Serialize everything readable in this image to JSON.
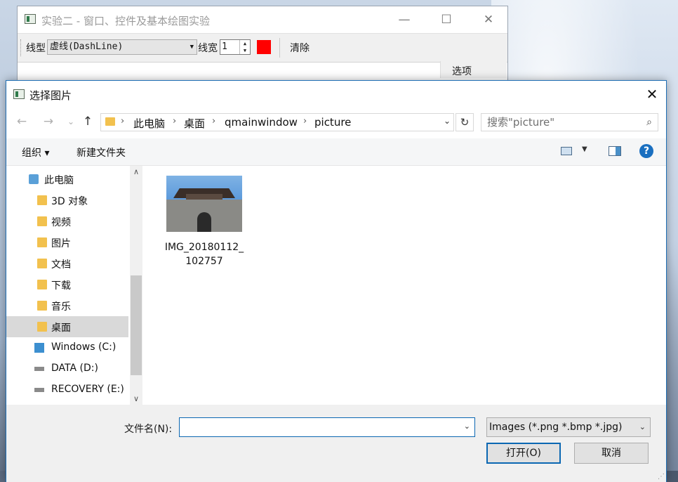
{
  "main_window": {
    "title": "实验二 - 窗口、控件及基本绘图实验",
    "controls": {
      "minimize": "—",
      "maximize": "☐",
      "close": "✕"
    },
    "toolbar": {
      "line_type_label": "线型",
      "line_type_value": "虚线(DashLine)",
      "line_width_label": "线宽",
      "line_width_value": "1",
      "color": "#ff0000",
      "clear_label": "清除"
    },
    "options_tab": "选项"
  },
  "dialog": {
    "title": "选择图片",
    "close": "✕",
    "nav": {
      "back": "←",
      "forward": "→",
      "recent": "⌄",
      "up": "↑",
      "refresh": "↻"
    },
    "breadcrumbs": [
      "此电脑",
      "桌面",
      "qmainwindow",
      "picture"
    ],
    "search_placeholder": "搜索\"picture\"",
    "commands": {
      "organize": "组织 ▾",
      "new_folder": "新建文件夹"
    },
    "nav_items": [
      {
        "label": "此电脑",
        "icon": "computer-icon"
      },
      {
        "label": "3D 对象",
        "icon": "3d-objects-folder-icon"
      },
      {
        "label": "视频",
        "icon": "videos-folder-icon"
      },
      {
        "label": "图片",
        "icon": "pictures-folder-icon"
      },
      {
        "label": "文档",
        "icon": "documents-folder-icon"
      },
      {
        "label": "下载",
        "icon": "downloads-folder-icon"
      },
      {
        "label": "音乐",
        "icon": "music-folder-icon"
      },
      {
        "label": "桌面",
        "icon": "desktop-folder-icon",
        "selected": true
      },
      {
        "label": "Windows (C:)",
        "icon": "drive-c-icon"
      },
      {
        "label": "DATA (D:)",
        "icon": "drive-icon"
      },
      {
        "label": "RECOVERY (E:)",
        "icon": "drive-icon"
      }
    ],
    "files": [
      {
        "name_line1": "IMG_20180112_",
        "name_line2": "102757"
      }
    ],
    "filename_label": "文件名(N):",
    "filename_value": "",
    "filter_value": "Images (*.png *.bmp *.jpg)",
    "open_label": "打开(O)",
    "cancel_label": "取消"
  }
}
